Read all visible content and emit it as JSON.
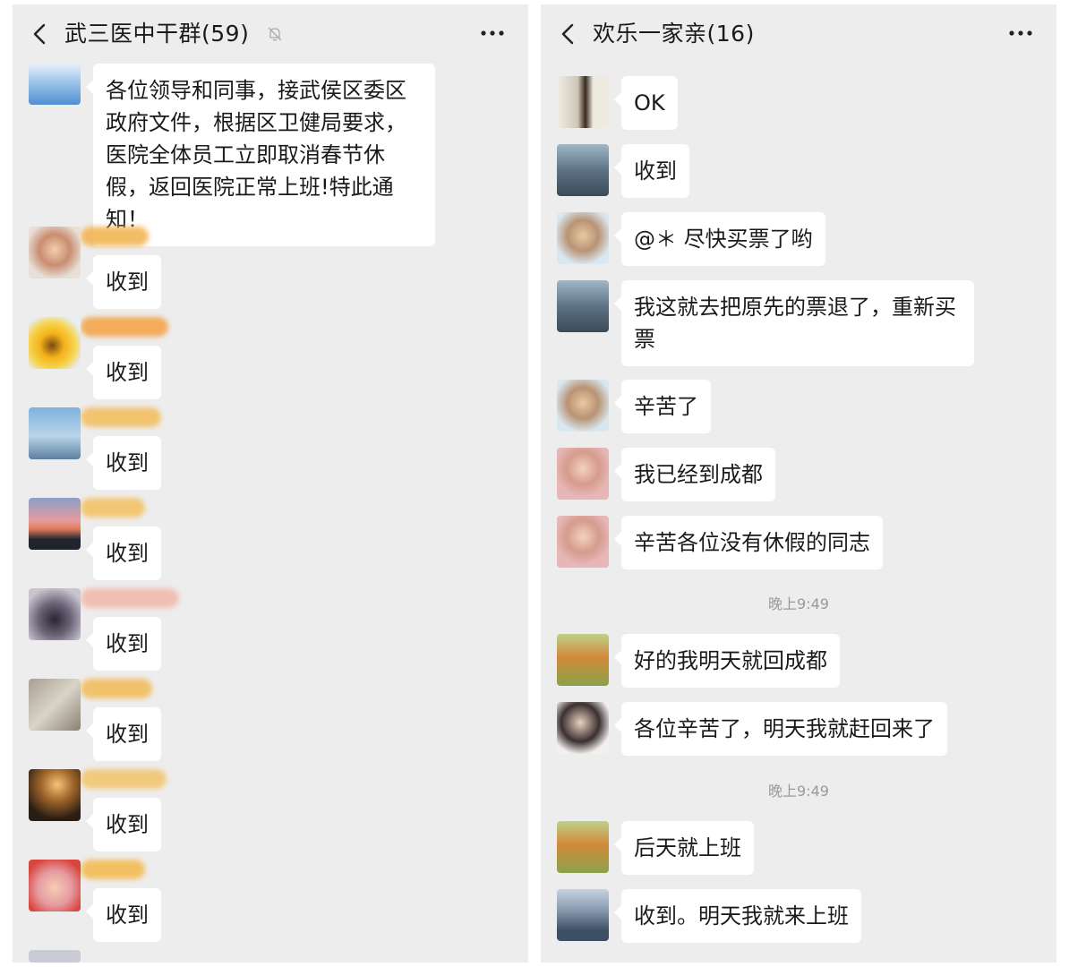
{
  "left_chat": {
    "title": "武三医中干群(59)",
    "messages": [
      {
        "text": "各位领导和同事，接武侯区委区政府文件，根据区卫健局要求，医院全体员工立即取消春节休假，返回医院正常上班!特此通知！"
      },
      {
        "text": "收到"
      },
      {
        "text": "收到"
      },
      {
        "text": "收到"
      },
      {
        "text": "收到"
      },
      {
        "text": "收到"
      },
      {
        "text": "收到"
      },
      {
        "text": "收到"
      },
      {
        "text": "收到"
      }
    ]
  },
  "right_chat": {
    "title": "欢乐一家亲(16)",
    "messages": [
      {
        "text": "OK"
      },
      {
        "text": "收到"
      },
      {
        "text": "@＊  尽快买票了哟"
      },
      {
        "text": "我这就去把原先的票退了，重新买票"
      },
      {
        "text": "辛苦了"
      },
      {
        "text": "我已经到成都"
      },
      {
        "text": "辛苦各位没有休假的同志"
      },
      {
        "time": "晚上9:49"
      },
      {
        "text": "好的我明天就回成都"
      },
      {
        "text": "各位辛苦了，明天我就赶回来了"
      },
      {
        "time": "晚上9:49"
      },
      {
        "text": "后天就上班"
      },
      {
        "text": "收到。明天我就来上班"
      }
    ]
  },
  "icons": {
    "back": "chevron-left-icon",
    "mute": "bell-off-icon",
    "more": "more-dots-icon"
  },
  "colors": {
    "background": "#ededed",
    "bubble": "#ffffff",
    "timestamp": "#9a9a9a"
  }
}
